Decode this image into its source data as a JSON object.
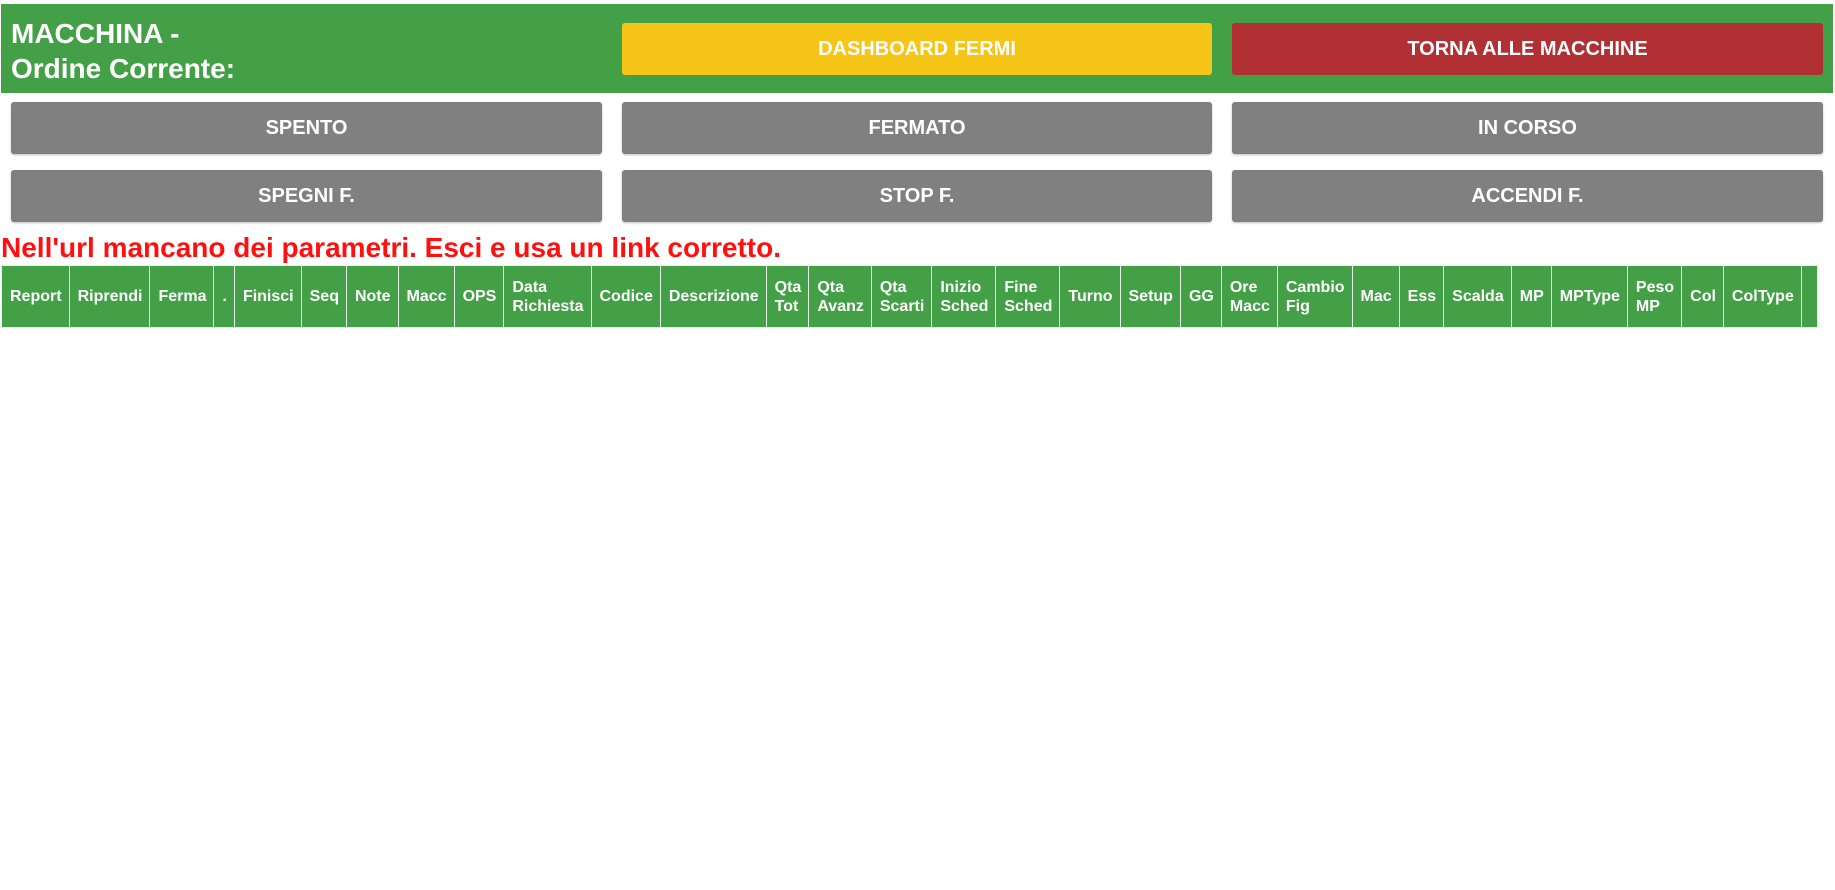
{
  "header": {
    "title_line1": "MACCHINA -",
    "title_line2": "Ordine Corrente:",
    "dashboard_button": "DASHBOARD FERMI",
    "back_button": "TORNA ALLE MACCHINE"
  },
  "status_buttons": {
    "spento": "SPENTO",
    "fermato": "FERMATO",
    "in_corso": "IN CORSO",
    "spegni": "SPEGNI F.",
    "stop": "STOP F.",
    "accendi": "ACCENDI F."
  },
  "error_message": "Nell'url mancano dei parametri. Esci e usa un link corretto.",
  "table": {
    "columns": [
      [
        "Report"
      ],
      [
        "Riprendi"
      ],
      [
        "Ferma"
      ],
      [
        "."
      ],
      [
        "Finisci"
      ],
      [
        "Seq"
      ],
      [
        "Note"
      ],
      [
        "Macc"
      ],
      [
        "OPS"
      ],
      [
        "Data",
        "Richiesta"
      ],
      [
        "Codice"
      ],
      [
        "Descrizione"
      ],
      [
        "Qta",
        "Tot"
      ],
      [
        "Qta",
        "Avanz"
      ],
      [
        "Qta",
        "Scarti"
      ],
      [
        "Inizio",
        "Sched"
      ],
      [
        "Fine",
        "Sched"
      ],
      [
        "Turno"
      ],
      [
        "Setup"
      ],
      [
        "GG"
      ],
      [
        "Ore",
        "Macc"
      ],
      [
        "Cambio",
        "Fig"
      ],
      [
        "Mac"
      ],
      [
        "Ess"
      ],
      [
        "Scalda"
      ],
      [
        "MP"
      ],
      [
        "MPType"
      ],
      [
        "Peso",
        "MP"
      ],
      [
        "Col"
      ],
      [
        "ColType"
      ],
      [
        ""
      ]
    ]
  },
  "colors": {
    "header_green": "#44a047",
    "dashboard_yellow": "#f5c518",
    "back_red": "#b03033",
    "button_grey": "#808080",
    "error_red": "#ff1010"
  }
}
